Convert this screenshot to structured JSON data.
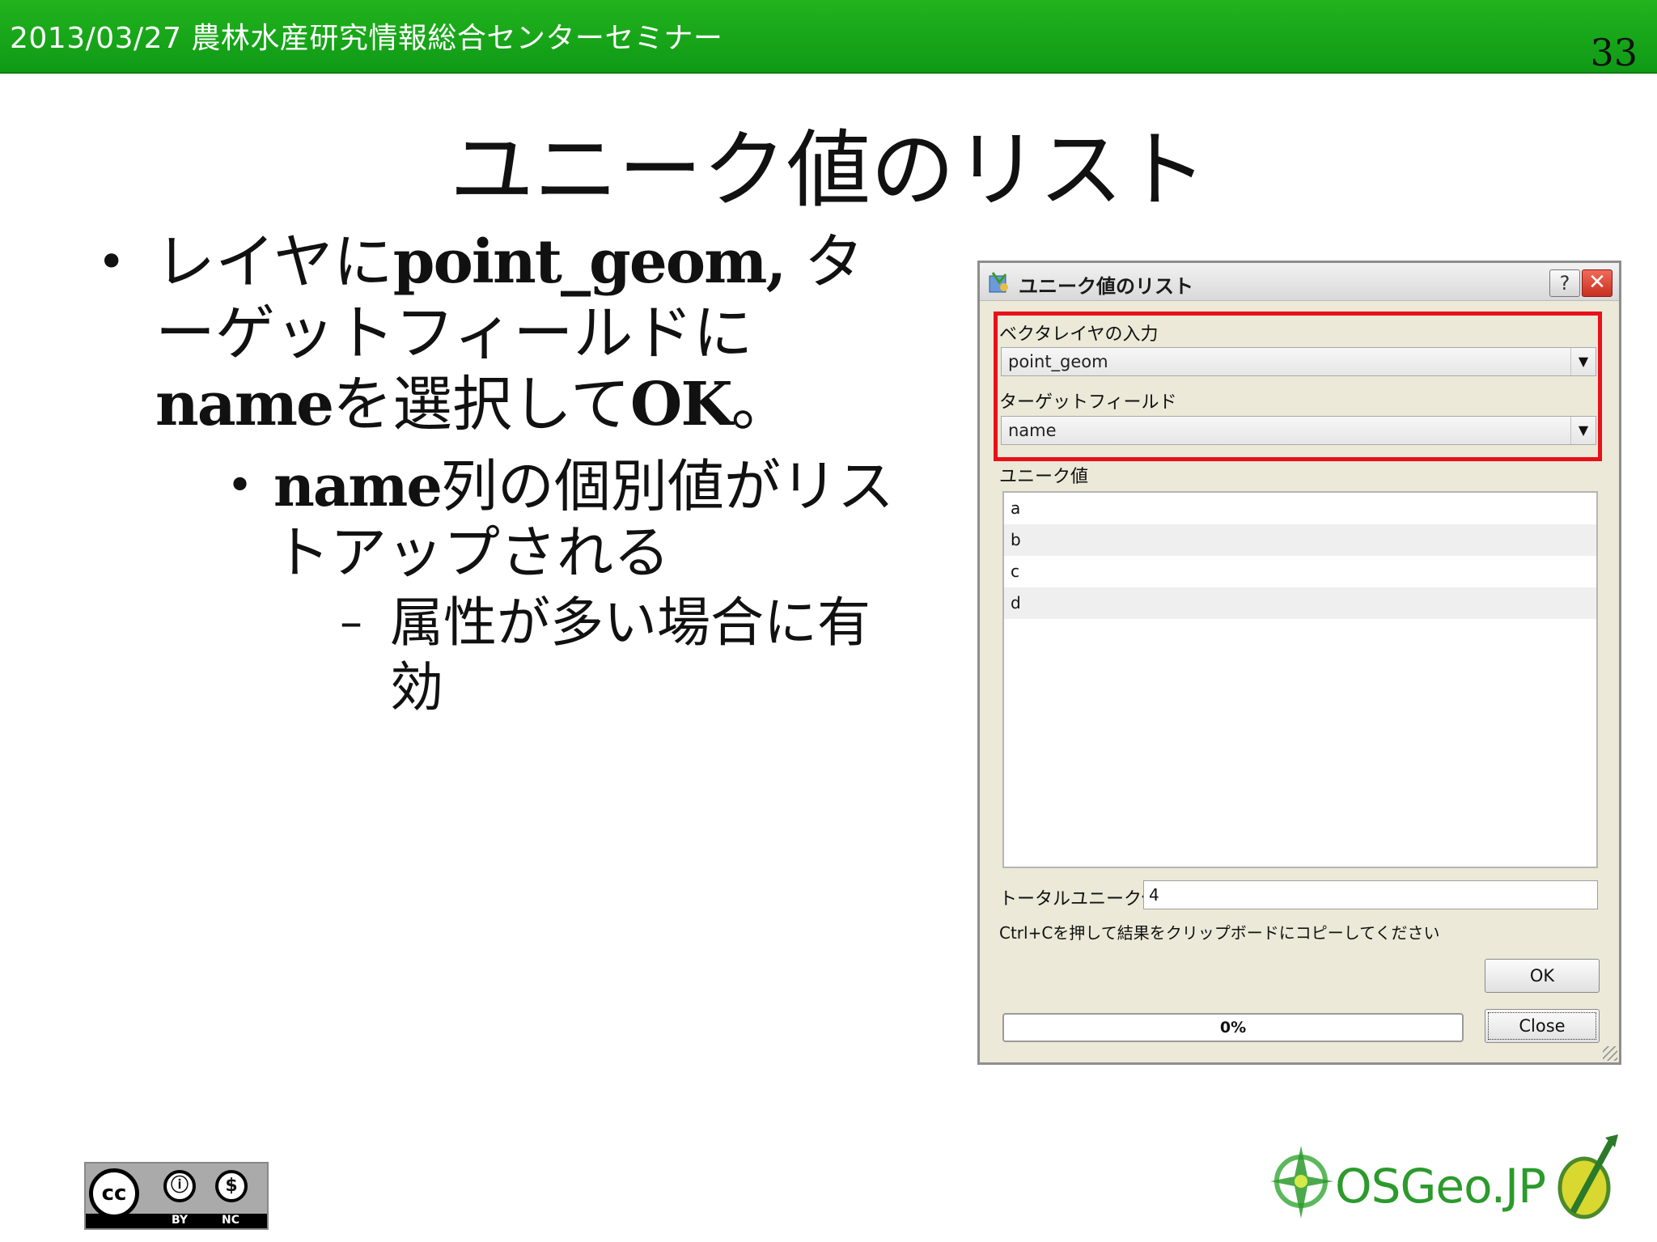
{
  "header": {
    "title": "2013/03/27 農林水産研究情報総合センターセミナー",
    "page_number": "33"
  },
  "slide": {
    "title": "ユニーク値のリスト",
    "bullet1": {
      "part1": "レイヤに",
      "code1": "point_geom,",
      "part2": " ターゲットフィールドに",
      "code2": "name",
      "part3": "を選択して",
      "code3": "OK",
      "part4": "。"
    },
    "bullet2": {
      "code": "name",
      "text": "列の個別値がリストアップされる"
    },
    "bullet3": {
      "text": "属性が多い場合に有効"
    }
  },
  "dialog": {
    "title": "ユニーク値のリスト",
    "help_label": "?",
    "close_label": "✕",
    "vector_layer_label": "ベクタレイヤの入力",
    "vector_layer_value": "point_geom",
    "target_field_label": "ターゲットフィールド",
    "target_field_value": "name",
    "unique_values_label": "ユニーク値",
    "unique_values": [
      "a",
      "b",
      "c",
      "d"
    ],
    "total_label": "トータルユニーク値",
    "total_value": "4",
    "hint": "Ctrl+Cを押して結果をクリップボードにコピーしてください",
    "ok_label": "OK",
    "close_button_label": "Close",
    "progress_text": "0%",
    "progress_value": 0.0,
    "highlight_color": "#e8101a"
  },
  "footer": {
    "cc_label": "cc",
    "cc_by": "BY",
    "cc_nc": "NC",
    "osgeo_text": "OSGeo.JP"
  }
}
